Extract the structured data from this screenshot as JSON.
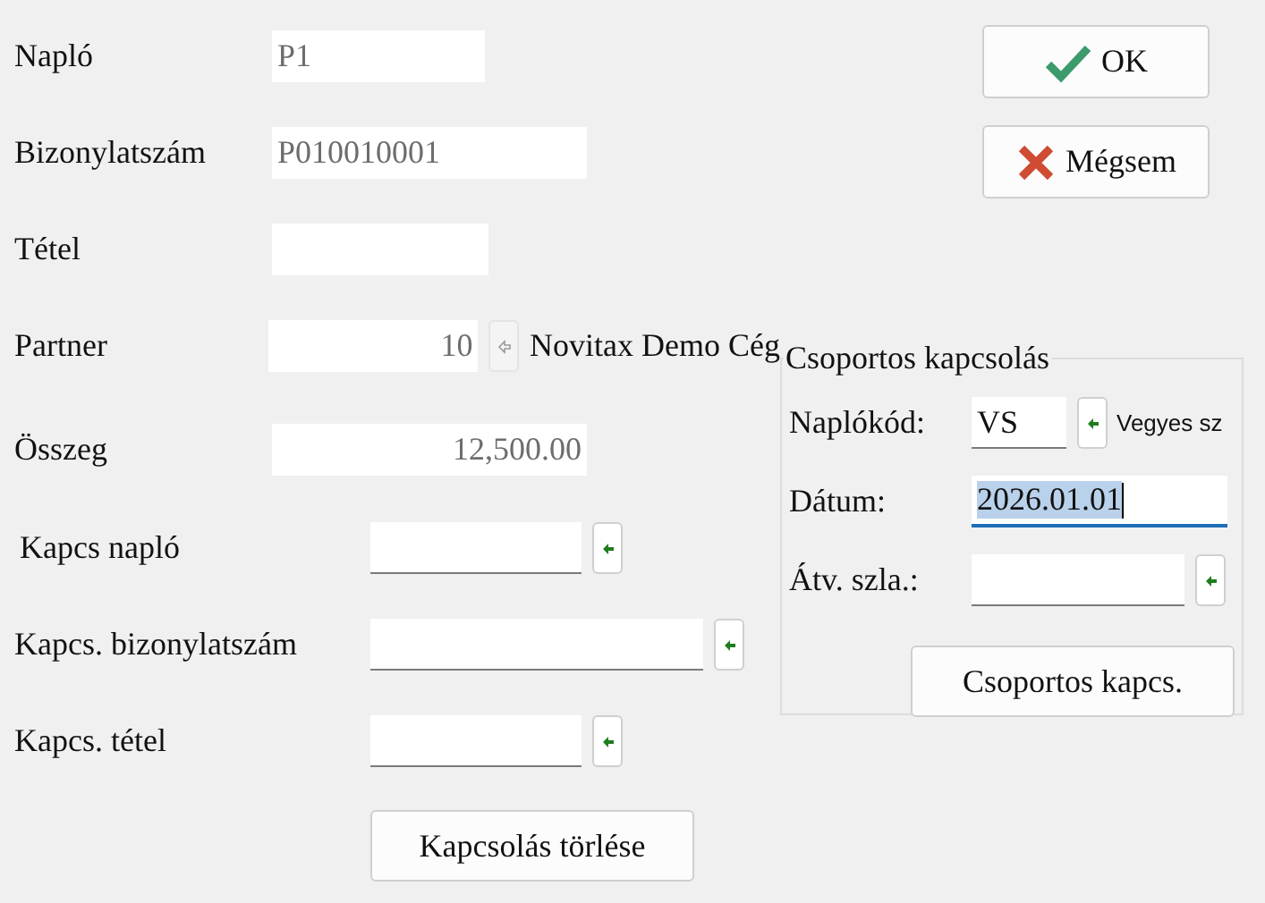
{
  "fields": [
    {
      "label": "Napló",
      "value": "P1",
      "kind": "text",
      "readonly": true
    },
    {
      "label": "Bizonylatszám",
      "value": "P010010001",
      "kind": "text",
      "readonly": true
    },
    {
      "label": "Tétel",
      "kind": "text",
      "readonly": true
    },
    {
      "label": "Partner",
      "value": "10",
      "kind": "number",
      "readonly": true,
      "lookup": {
        "disabled": true
      },
      "note": "Novitax Demo Cég"
    },
    {
      "label": "Összeg",
      "value": "12,500.00",
      "kind": "number",
      "readonly": true
    }
  ],
  "buttons": [
    {
      "label": "OK",
      "kind": "ok"
    },
    {
      "label": "Mégsem",
      "kind": "cancel"
    }
  ],
  "link_fields": [
    {
      "label": "Kapcs napló",
      "lookup": {
        "disabled": false
      }
    },
    {
      "label": "Kapcs. bizonylatszám",
      "lookup": {
        "disabled": false
      }
    },
    {
      "label": "Kapcs. tétel",
      "lookup": {
        "disabled": false
      }
    }
  ],
  "clear_button": "Kapcsolás törlése",
  "group": {
    "title": "Csoportos kapcsolás",
    "fields": [
      {
        "label": "Naplókód:",
        "value": "VS",
        "focused": false,
        "lookup": {
          "disabled": false
        },
        "note": "Vegyes sz"
      },
      {
        "label": "Dátum:",
        "value": "2026.01.01",
        "focused": true
      },
      {
        "label": "Átv. szla.:",
        "focused": false,
        "lookup": {
          "disabled": false
        }
      }
    ],
    "button": "Csoportos kapcs."
  }
}
